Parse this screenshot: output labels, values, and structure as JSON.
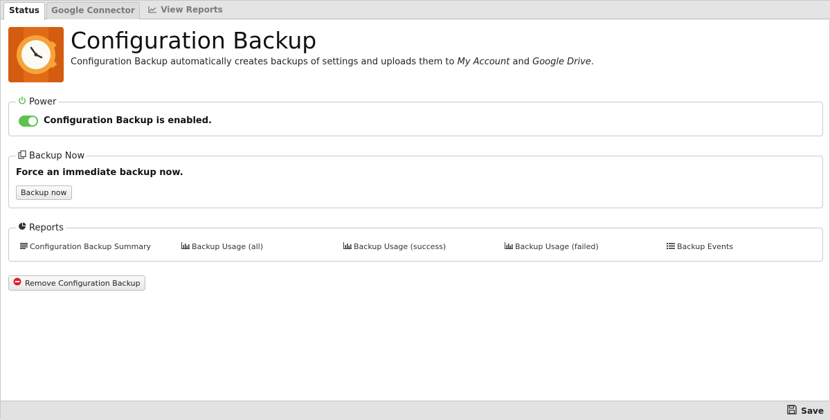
{
  "tabs": [
    {
      "label": "Status",
      "active": true
    },
    {
      "label": "Google Connector",
      "active": false
    },
    {
      "label": "View Reports",
      "active": false,
      "icon": "line-chart-icon"
    }
  ],
  "header": {
    "title": "Configuration Backup",
    "description_parts": [
      "Configuration Backup automatically creates backups of settings and uploads them to ",
      "My Account",
      " and ",
      "Google Drive",
      "."
    ],
    "icon": "clock-app-icon"
  },
  "power": {
    "legend": "Power",
    "status_text": "Configuration Backup is enabled.",
    "enabled": true,
    "accent": "#5cc34e"
  },
  "backup_now": {
    "legend": "Backup Now",
    "text": "Force an immediate backup now.",
    "button_label": "Backup now"
  },
  "reports": {
    "legend": "Reports",
    "links": [
      {
        "label": "Configuration Backup Summary",
        "icon": "list-lines-icon"
      },
      {
        "label": "Backup Usage (all)",
        "icon": "bar-chart-icon"
      },
      {
        "label": "Backup Usage (success)",
        "icon": "bar-chart-icon"
      },
      {
        "label": "Backup Usage (failed)",
        "icon": "bar-chart-icon"
      },
      {
        "label": "Backup Events",
        "icon": "bullet-list-icon"
      }
    ]
  },
  "remove_button_label": "Remove Configuration Backup",
  "footer": {
    "save_label": "Save"
  },
  "colors": {
    "app_icon_orange": "#e06a16",
    "remove_red": "#d9232a"
  }
}
